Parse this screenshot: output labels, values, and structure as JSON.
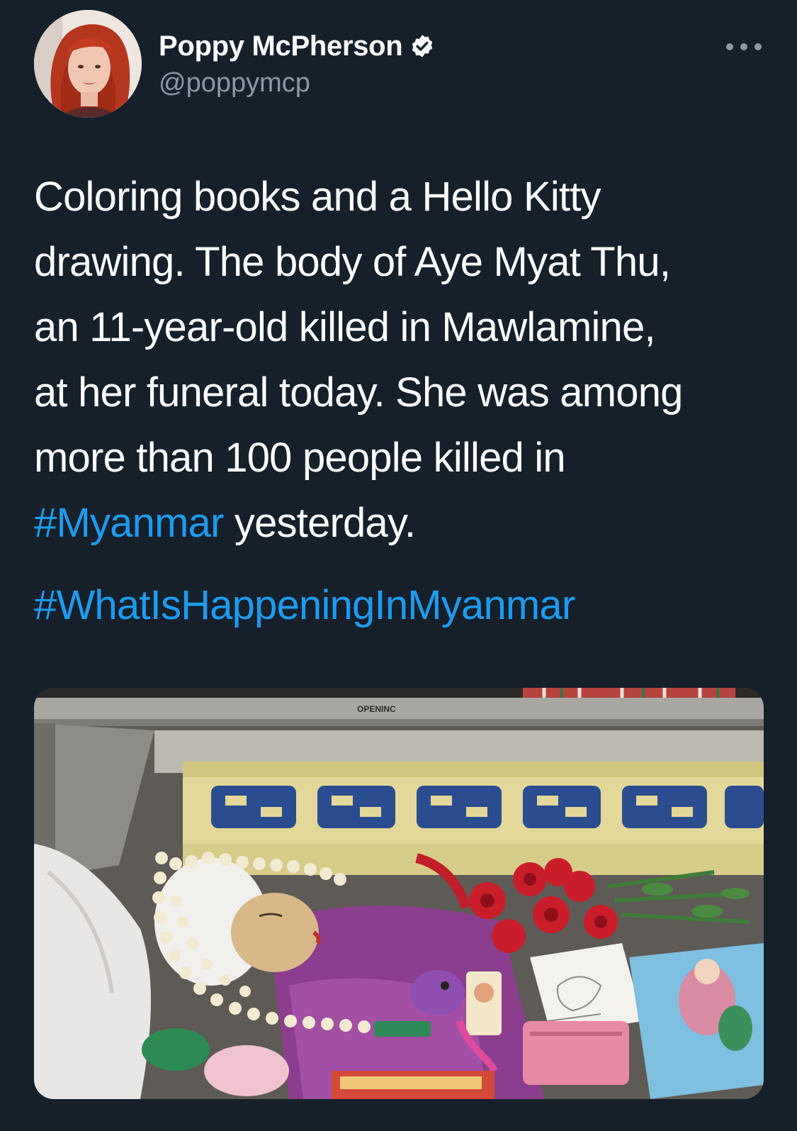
{
  "author": {
    "display_name": "Poppy McPherson",
    "handle": "@poppymcp",
    "verified": true
  },
  "icons": {
    "verified": "verified-badge-icon",
    "more": "more-options-icon"
  },
  "tweet": {
    "line1": "Coloring books and a Hello Kitty",
    "line2": "drawing. The body of Aye Myat Thu,",
    "line3": "an 11-year-old killed in Mawlamine,",
    "line4": "at her funeral today. She was among",
    "line5": "more than 100 people killed in",
    "hashtag1": "#Myanmar",
    "line6_rest": " yesterday.",
    "hashtag2": "#WhatIsHappeningInMyanmar"
  },
  "media": {
    "coffin_label": "OPENINC"
  },
  "colors": {
    "background": "#15202b",
    "text": "#ffffff",
    "secondary": "#8b98a5",
    "link": "#1d9bf0"
  }
}
